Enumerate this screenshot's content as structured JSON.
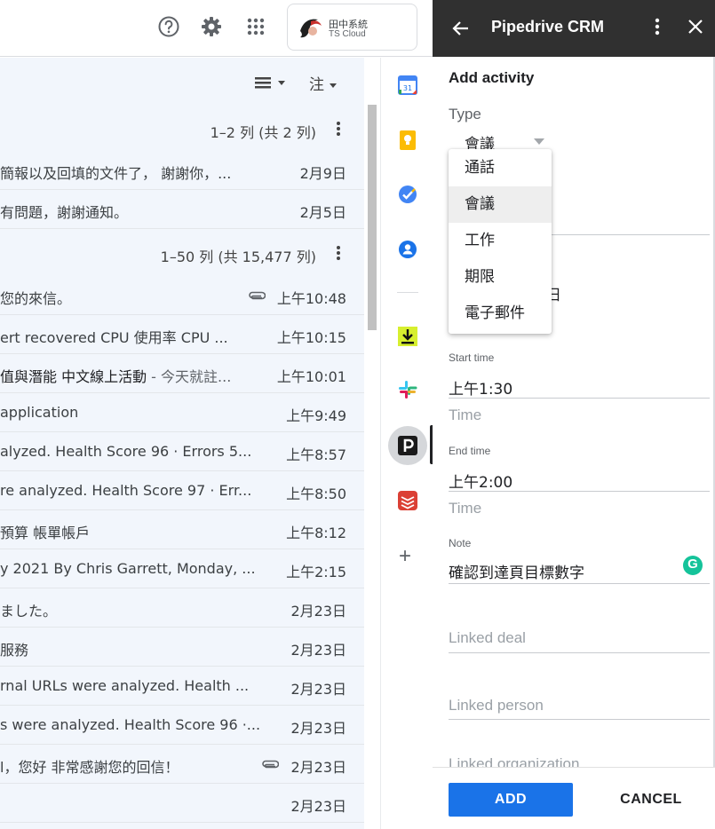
{
  "gmail": {
    "account": {
      "name": "田中系統",
      "sub": "TS Cloud"
    },
    "toolbar": {
      "language": "注"
    },
    "sections": [
      {
        "range": "1–2 列 (共 2 列)"
      },
      {
        "range": "1–50 列 (共 15,477 列)"
      }
    ],
    "rows": [
      {
        "subject": "簡報以及回填的文件了， 謝謝你，...",
        "time": "2月9日",
        "attach": false,
        "bold": false
      },
      {
        "subject": "有問題，謝謝通知。",
        "time": "2月5日",
        "attach": false,
        "bold": false
      },
      {
        "subject": "您的來信。",
        "time": "上午10:48",
        "attach": true,
        "bold": false
      },
      {
        "subject": "ert recovered CPU 使用率 CPU ...",
        "time": "上午10:15",
        "attach": false,
        "bold": false
      },
      {
        "subject": "值與潛能 中文線上活動",
        "subject_rest": " - 今天就註...",
        "time": "上午10:01",
        "attach": false,
        "bold": true
      },
      {
        "subject": " application",
        "time": "上午9:49",
        "attach": false,
        "bold": false
      },
      {
        "subject": "alyzed. Health Score 96 · Errors 5...",
        "time": "上午8:57",
        "attach": false,
        "bold": false
      },
      {
        "subject": "re analyzed. Health Score 97 · Err...",
        "time": "上午8:50",
        "attach": false,
        "bold": false
      },
      {
        "subject": "預算 帳單帳戶",
        "time": "上午8:12",
        "attach": false,
        "bold": false
      },
      {
        "subject": "y 2021 By Chris Garrett, Monday, ...",
        "time": "上午2:15",
        "attach": false,
        "bold": false
      },
      {
        "subject": "ました。",
        "time": "2月23日",
        "attach": false,
        "bold": false
      },
      {
        "subject": "服務",
        "time": "2月23日",
        "attach": false,
        "bold": false
      },
      {
        "subject": "rnal URLs were analyzed. Health ...",
        "time": "2月23日",
        "attach": false,
        "bold": false
      },
      {
        "subject": "s were analyzed. Health Score 96 ·...",
        "time": "2月23日",
        "attach": false,
        "bold": false
      },
      {
        "subject": "l，您好 非常感謝您的回信！",
        "time": "2月23日",
        "attach": true,
        "bold": false
      },
      {
        "subject": "",
        "time": "2月23日",
        "attach": false,
        "bold": false
      }
    ]
  },
  "panel": {
    "title": "Pipedrive CRM",
    "section": "Add activity",
    "type_label": "Type",
    "type_value": "會議",
    "hidden_fragment": "日",
    "start_time_label": "Start time",
    "start_time_value": "上午1:30",
    "start_time_placeholder": "Time",
    "end_time_label": "End time",
    "end_time_value": "上午2:00",
    "end_time_placeholder": "Time",
    "note_label": "Note",
    "note_value": "確認到達頁目標數字",
    "grammarly_letter": "G",
    "linked_deal": "Linked deal",
    "linked_person": "Linked person",
    "cutoff_text": "Linked organization",
    "add_label": "ADD",
    "cancel_label": "CANCEL"
  },
  "dropdown": {
    "options": [
      "通話",
      "會議",
      "工作",
      "期限",
      "電子郵件"
    ],
    "selected_index": 1
  },
  "colors": {
    "panel_header": "#303030",
    "primary": "#1a73e8",
    "list_bg": "#f2f6fc",
    "grammarly": "#15c39a"
  }
}
